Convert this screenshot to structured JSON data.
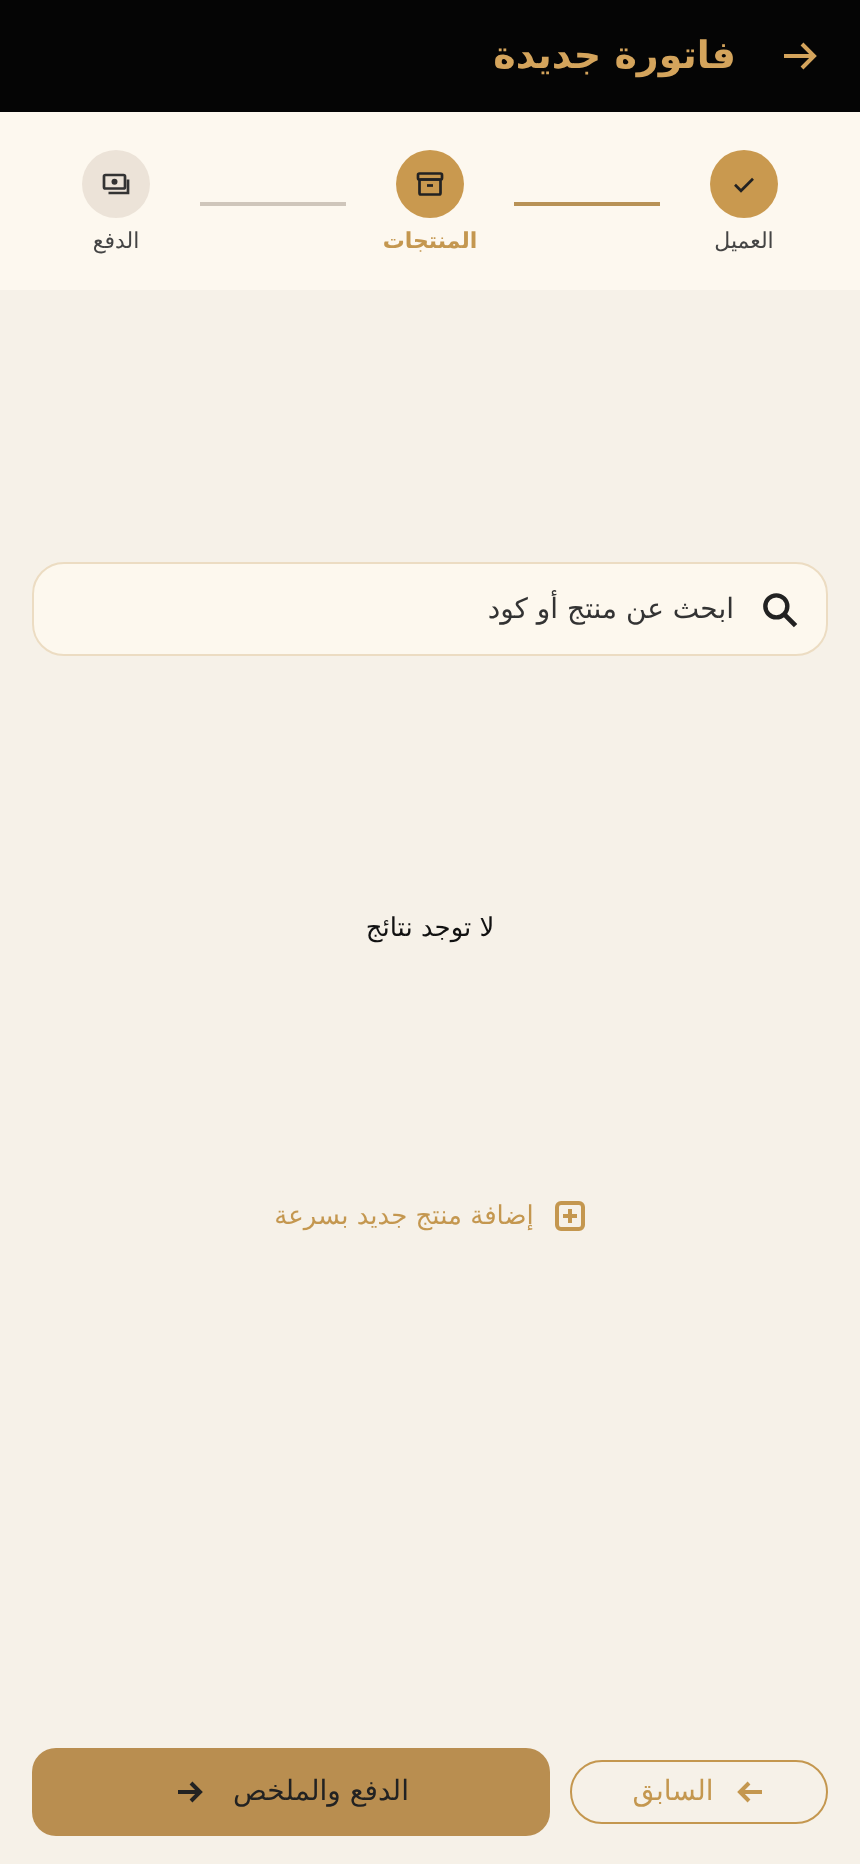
{
  "header": {
    "title": "فاتورة جديدة"
  },
  "steps": [
    {
      "label": "العميل",
      "done": true,
      "selected": false
    },
    {
      "label": "المنتجات",
      "done": false,
      "selected": true
    },
    {
      "label": "الدفع",
      "done": false,
      "selected": false
    }
  ],
  "search": {
    "placeholder": "ابحث عن منتج أو كود"
  },
  "empty_message": "لا توجد نتائج",
  "quick_add": "إضافة منتج جديد بسرعة",
  "buttons": {
    "next": "الدفع والملخص",
    "previous": "السابق"
  }
}
